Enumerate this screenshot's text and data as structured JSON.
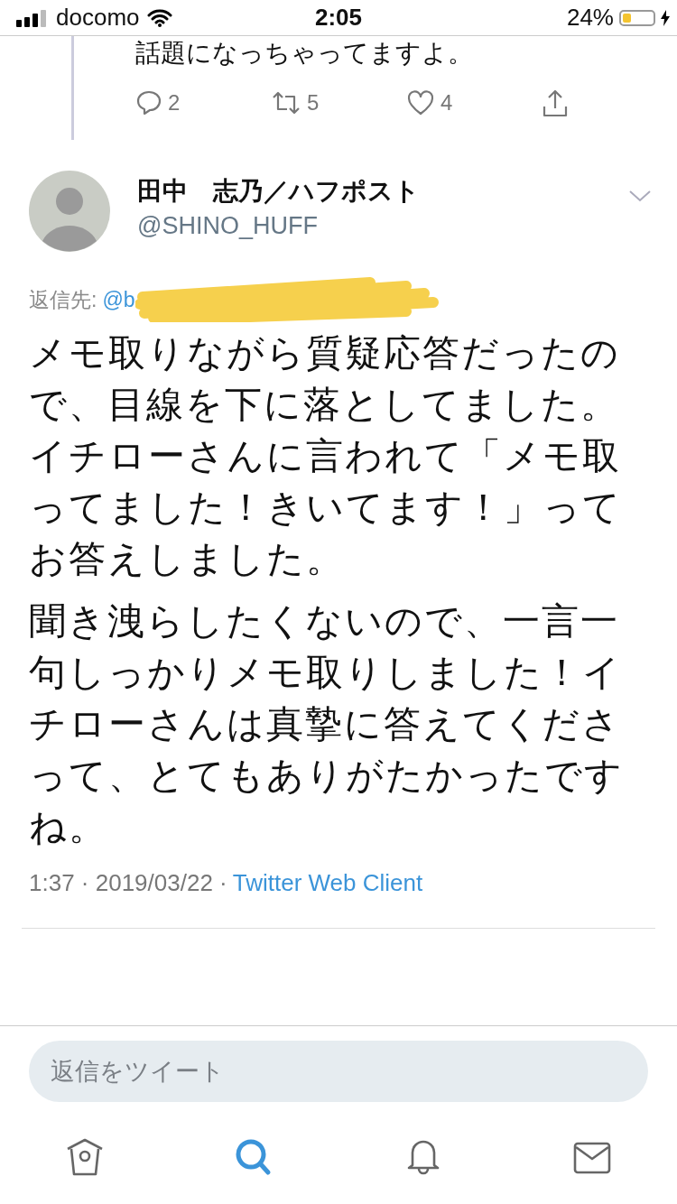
{
  "status_bar": {
    "carrier": "docomo",
    "time": "2:05",
    "battery": "24%"
  },
  "previous_tweet": {
    "text": "話題になっちゃってますよ。",
    "actions": [
      {
        "kind": "reply",
        "count": "2"
      },
      {
        "kind": "retweet",
        "count": "5"
      },
      {
        "kind": "like",
        "count": "4"
      },
      {
        "kind": "share"
      }
    ]
  },
  "tweet": {
    "name": "田中　志乃／ハフポスト",
    "handle": "@SHINO_HUFF",
    "reply_label": "返信先:",
    "reply_handle": "@b",
    "paragraphs": [
      "メモ取りながら質疑応答だったので、目線を下に落としてました。イチローさんに言われて「メモ取ってました！きいてます！」ってお答えしました。",
      "聞き洩らしたくないので、一言一句しっかりメモ取りしました！イチローさんは真摯に答えてくださって、とてもありがたかったですね。"
    ],
    "time": "1:37 · 2019/03/22 ·",
    "source": "Twitter Web Client"
  },
  "reply_field": {
    "placeholder": "返信をツイート"
  },
  "tab_bar": [
    {
      "kind": "home",
      "selected": false
    },
    {
      "kind": "search",
      "selected": true
    },
    {
      "kind": "notifications",
      "selected": false
    },
    {
      "kind": "messages",
      "selected": false
    }
  ]
}
